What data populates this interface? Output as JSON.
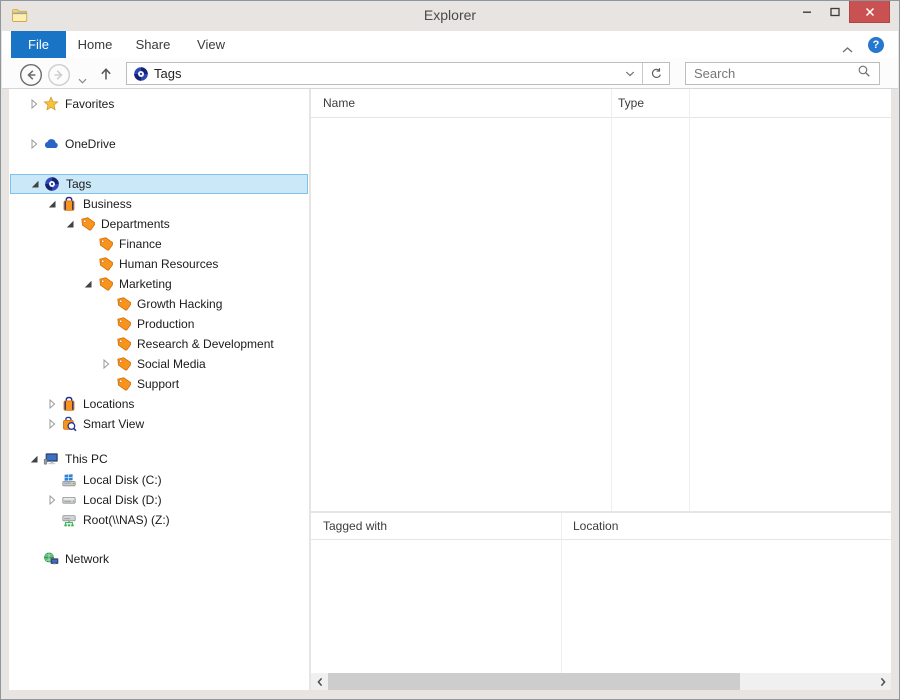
{
  "window": {
    "title": "Explorer"
  },
  "ribbon": {
    "tabs": [
      {
        "label": "File",
        "active": true
      },
      {
        "label": "Home",
        "active": false
      },
      {
        "label": "Share",
        "active": false
      },
      {
        "label": "View",
        "active": false
      }
    ],
    "help_glyph": "?"
  },
  "navbar": {
    "address_text": "Tags",
    "search_placeholder": "Search"
  },
  "tree": {
    "items": [
      {
        "label": "Favorites",
        "level": 0,
        "expand": "collapsed",
        "icon": "star",
        "selected": false,
        "gap_before": 0
      },
      {
        "label": "OneDrive",
        "level": 0,
        "expand": "collapsed",
        "icon": "cloud",
        "selected": false,
        "gap_before": 20
      },
      {
        "label": "Tags",
        "level": 0,
        "expand": "expanded",
        "icon": "tags-logo",
        "selected": true,
        "gap_before": 20
      },
      {
        "label": "Business",
        "level": 1,
        "expand": "expanded",
        "icon": "bag",
        "selected": false,
        "gap_before": 0
      },
      {
        "label": "Departments",
        "level": 2,
        "expand": "expanded",
        "icon": "tag",
        "selected": false,
        "gap_before": 0
      },
      {
        "label": "Finance",
        "level": 3,
        "expand": "none",
        "icon": "tag",
        "selected": false,
        "gap_before": 0
      },
      {
        "label": "Human Resources",
        "level": 3,
        "expand": "none",
        "icon": "tag",
        "selected": false,
        "gap_before": 0
      },
      {
        "label": "Marketing",
        "level": 3,
        "expand": "expanded",
        "icon": "tag",
        "selected": false,
        "gap_before": 0
      },
      {
        "label": "Growth Hacking",
        "level": 4,
        "expand": "none",
        "icon": "tag",
        "selected": false,
        "gap_before": 0
      },
      {
        "label": "Production",
        "level": 4,
        "expand": "none",
        "icon": "tag",
        "selected": false,
        "gap_before": 0
      },
      {
        "label": "Research & Development",
        "level": 4,
        "expand": "none",
        "icon": "tag",
        "selected": false,
        "gap_before": 0
      },
      {
        "label": "Social Media",
        "level": 4,
        "expand": "collapsed",
        "icon": "tag",
        "selected": false,
        "gap_before": 0
      },
      {
        "label": "Support",
        "level": 4,
        "expand": "none",
        "icon": "tag",
        "selected": false,
        "gap_before": 0
      },
      {
        "label": "Locations",
        "level": 1,
        "expand": "collapsed",
        "icon": "bag",
        "selected": false,
        "gap_before": 0
      },
      {
        "label": "Smart View",
        "level": 1,
        "expand": "collapsed",
        "icon": "bag-search",
        "selected": false,
        "gap_before": 0
      },
      {
        "label": "This PC",
        "level": 0,
        "expand": "expanded",
        "icon": "computer",
        "selected": false,
        "gap_before": 15
      },
      {
        "label": "Local Disk (C:)",
        "level": 1,
        "expand": "none",
        "icon": "disk-win",
        "selected": false,
        "gap_before": 1
      },
      {
        "label": "Local Disk (D:)",
        "level": 1,
        "expand": "collapsed",
        "icon": "disk",
        "selected": false,
        "gap_before": 0
      },
      {
        "label": "Root(\\\\NAS) (Z:)",
        "level": 1,
        "expand": "none",
        "icon": "disk-net",
        "selected": false,
        "gap_before": 0
      },
      {
        "label": "Network",
        "level": 0,
        "expand": "none",
        "icon": "network",
        "selected": false,
        "gap_before": 19
      }
    ]
  },
  "main": {
    "columns": [
      "Name",
      "Type"
    ]
  },
  "bottom": {
    "columns": [
      "Tagged with",
      "Location"
    ]
  },
  "icons": {
    "star": "gold-star",
    "cloud": "onedrive-blue-cloud",
    "tags-logo": "blue-swirl-tags-logo",
    "bag": "orange-bag-blue-handle",
    "bag-search": "orange-bag-magnifier",
    "tag": "orange-label-tag",
    "computer": "pc-monitor",
    "disk-win": "system-disk-windows-flag",
    "disk": "gray-disk",
    "disk-net": "network-disk-green",
    "network": "globe-with-monitor"
  },
  "colors": {
    "accent_blue": "#1974c6",
    "selection_bg": "#cbe8f8",
    "selection_border": "#7fc3ea",
    "tag_orange": "#f7941e",
    "close_red": "#c95151",
    "titlebar_bg": "#e7e4e1"
  }
}
